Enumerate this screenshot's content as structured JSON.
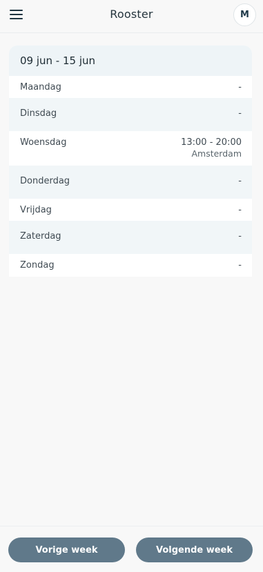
{
  "header": {
    "title": "Rooster",
    "avatar_initial": "M"
  },
  "schedule": {
    "week_range": "09 jun - 15 jun",
    "days": [
      {
        "name": "Maandag",
        "value": "-",
        "sub": ""
      },
      {
        "name": "Dinsdag",
        "value": "-",
        "sub": ""
      },
      {
        "name": "Woensdag",
        "value": "13:00 - 20:00",
        "sub": "Amsterdam"
      },
      {
        "name": "Donderdag",
        "value": "-",
        "sub": ""
      },
      {
        "name": "Vrijdag",
        "value": "-",
        "sub": ""
      },
      {
        "name": "Zaterdag",
        "value": "-",
        "sub": ""
      },
      {
        "name": "Zondag",
        "value": "-",
        "sub": ""
      }
    ]
  },
  "footer": {
    "prev_label": "Vorige week",
    "next_label": "Volgende week"
  },
  "colors": {
    "background": "#f8f8f8",
    "header_tint": "#eef4f7",
    "button": "#60798a"
  }
}
